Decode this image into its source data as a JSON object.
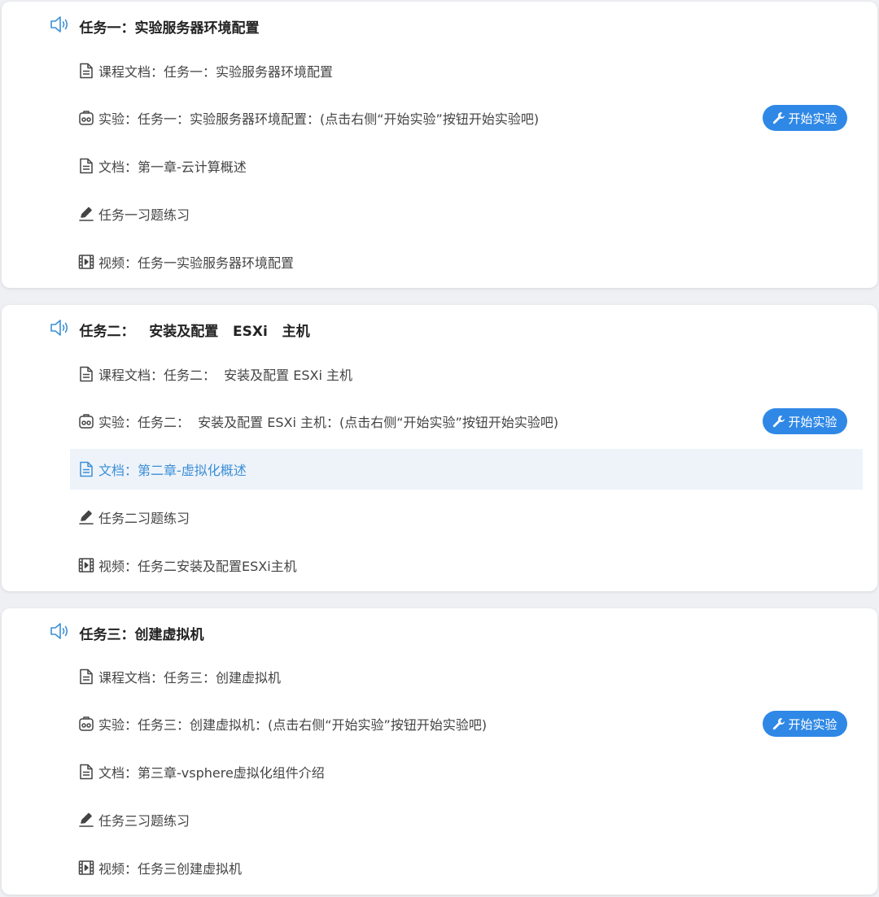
{
  "colors": {
    "accent": "#2f88e6",
    "speaker": "#3b8fd6",
    "active_bg": "#eef3fa",
    "active_text": "#3b8fd6"
  },
  "tasks": [
    {
      "title": "任务一：实验服务器环境配置",
      "items": [
        {
          "icon": "document-icon",
          "label": "课程文档：任务一：实验服务器环境配置"
        },
        {
          "icon": "lab-icon",
          "label": "实验：任务一：实验服务器环境配置：(点击右侧“开始实验”按钮开始实验吧)",
          "button": "开始实验"
        },
        {
          "icon": "document-icon",
          "label": "文档：第一章-云计算概述"
        },
        {
          "icon": "pen-icon",
          "label": "任务一习题练习"
        },
        {
          "icon": "video-icon",
          "label": "视频：任务一实验服务器环境配置"
        }
      ]
    },
    {
      "title": "任务二：   安装及配置   ESXi   主机",
      "items": [
        {
          "icon": "document-icon",
          "label": "课程文档：任务二：  安装及配置 ESXi 主机"
        },
        {
          "icon": "lab-icon",
          "label": "实验：任务二：  安装及配置 ESXi 主机：(点击右侧“开始实验”按钮开始实验吧)",
          "button": "开始实验"
        },
        {
          "icon": "document-icon",
          "label": "文档：第二章-虚拟化概述",
          "active": true
        },
        {
          "icon": "pen-icon",
          "label": "任务二习题练习"
        },
        {
          "icon": "video-icon",
          "label": "视频：任务二安装及配置ESXi主机"
        }
      ]
    },
    {
      "title": "任务三：创建虚拟机",
      "items": [
        {
          "icon": "document-icon",
          "label": "课程文档：任务三：创建虚拟机"
        },
        {
          "icon": "lab-icon",
          "label": "实验：任务三：创建虚拟机：(点击右侧“开始实验”按钮开始实验吧)",
          "button": "开始实验"
        },
        {
          "icon": "document-icon",
          "label": "文档：第三章-vsphere虚拟化组件介绍"
        },
        {
          "icon": "pen-icon",
          "label": "任务三习题练习"
        },
        {
          "icon": "video-icon",
          "label": "视频：任务三创建虚拟机"
        }
      ]
    }
  ]
}
